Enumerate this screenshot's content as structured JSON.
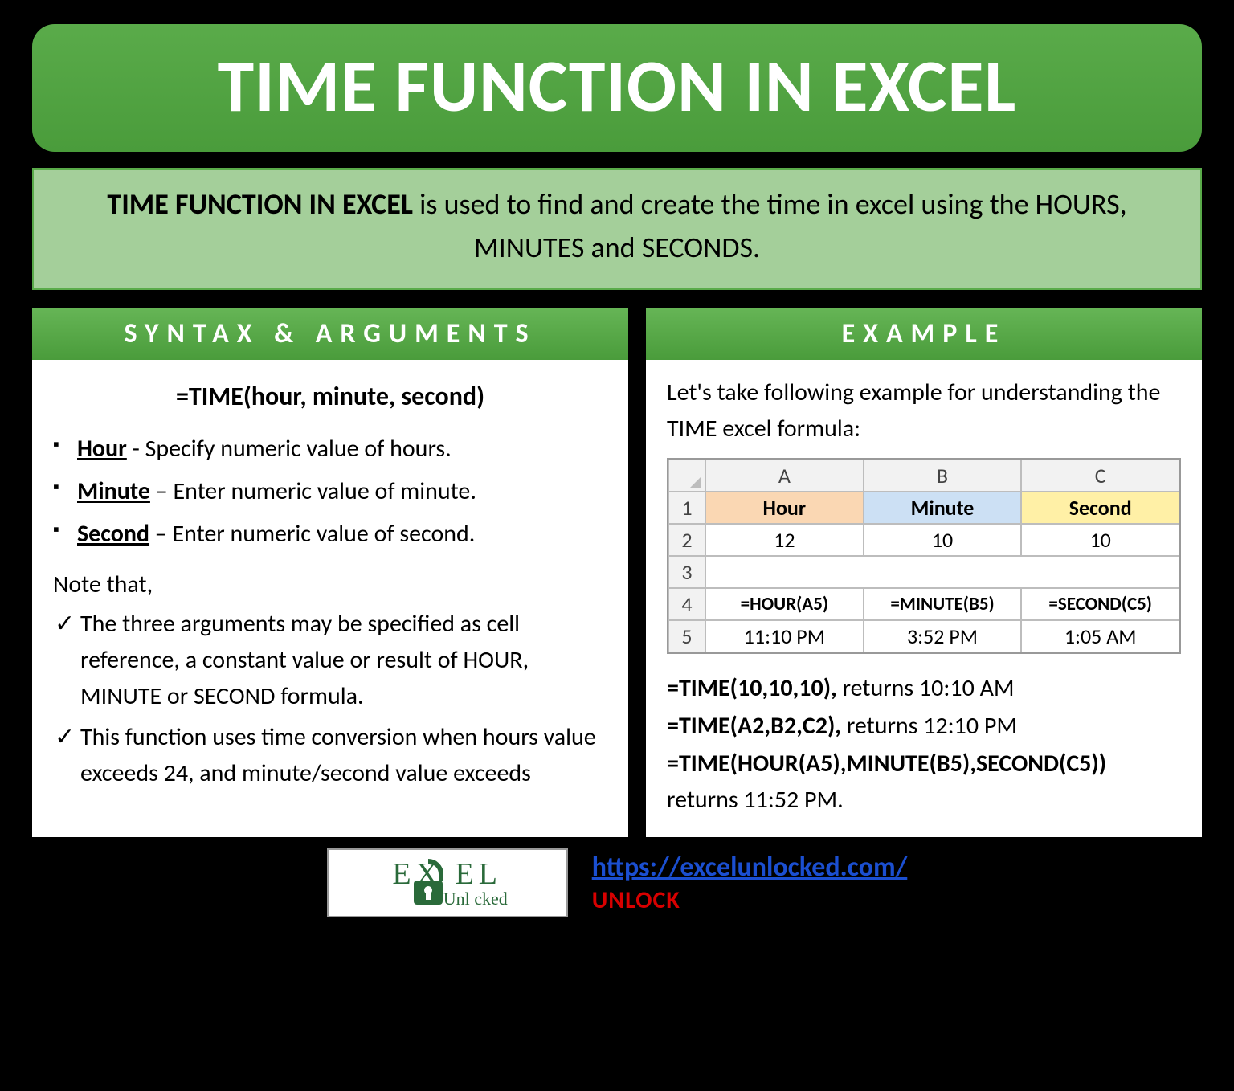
{
  "title": "TIME FUNCTION IN EXCEL",
  "intro": {
    "bold": "TIME FUNCTION IN EXCEL",
    "rest": " is used to find and create the time in excel using the HOURS, MINUTES and SECONDS."
  },
  "syntax": {
    "header": "SYNTAX & ARGUMENTS",
    "formula": "=TIME(hour, minute, second)",
    "args": [
      {
        "name": "Hour",
        "desc": " - Specify numeric value of hours."
      },
      {
        "name": "Minute",
        "desc": " – Enter numeric value of minute."
      },
      {
        "name": "Second",
        "desc": " – Enter numeric value of second."
      }
    ],
    "note_label": "Note that,",
    "notes": [
      "The three arguments may be specified as cell reference, a constant value or result of HOUR, MINUTE or SECOND formula.",
      "This function uses time conversion when hours value exceeds 24, and minute/second value exceeds"
    ]
  },
  "example": {
    "header": "EXAMPLE",
    "intro": "Let's take following example for understanding the TIME excel formula:",
    "grid": {
      "col_headers": [
        "A",
        "B",
        "C"
      ],
      "row1": {
        "n": "1",
        "a": "Hour",
        "b": "Minute",
        "c": "Second"
      },
      "row2": {
        "n": "2",
        "a": "12",
        "b": "10",
        "c": "10"
      },
      "row3": {
        "n": "3"
      },
      "row4": {
        "n": "4",
        "a": "=HOUR(A5)",
        "b": "=MINUTE(B5)",
        "c": "=SECOND(C5)"
      },
      "row5": {
        "n": "5",
        "a": "11:10 PM",
        "b": "3:52 PM",
        "c": "1:05 AM"
      }
    },
    "results": [
      {
        "formula": "=TIME(10,10,10),",
        "ret": " returns 10:10 AM"
      },
      {
        "formula": "=TIME(A2,B2,C2),",
        "ret": " returns 12:10 PM"
      },
      {
        "formula": "=TIME(HOUR(A5),MINUTE(B5),SECOND(C5))",
        "ret": " returns 11:52 PM."
      }
    ]
  },
  "footer": {
    "logo_line1": "EX   EL",
    "logo_line2": "Unl   cked",
    "url": "https://excelunlocked.com/",
    "unlock": "UNLOCK"
  }
}
